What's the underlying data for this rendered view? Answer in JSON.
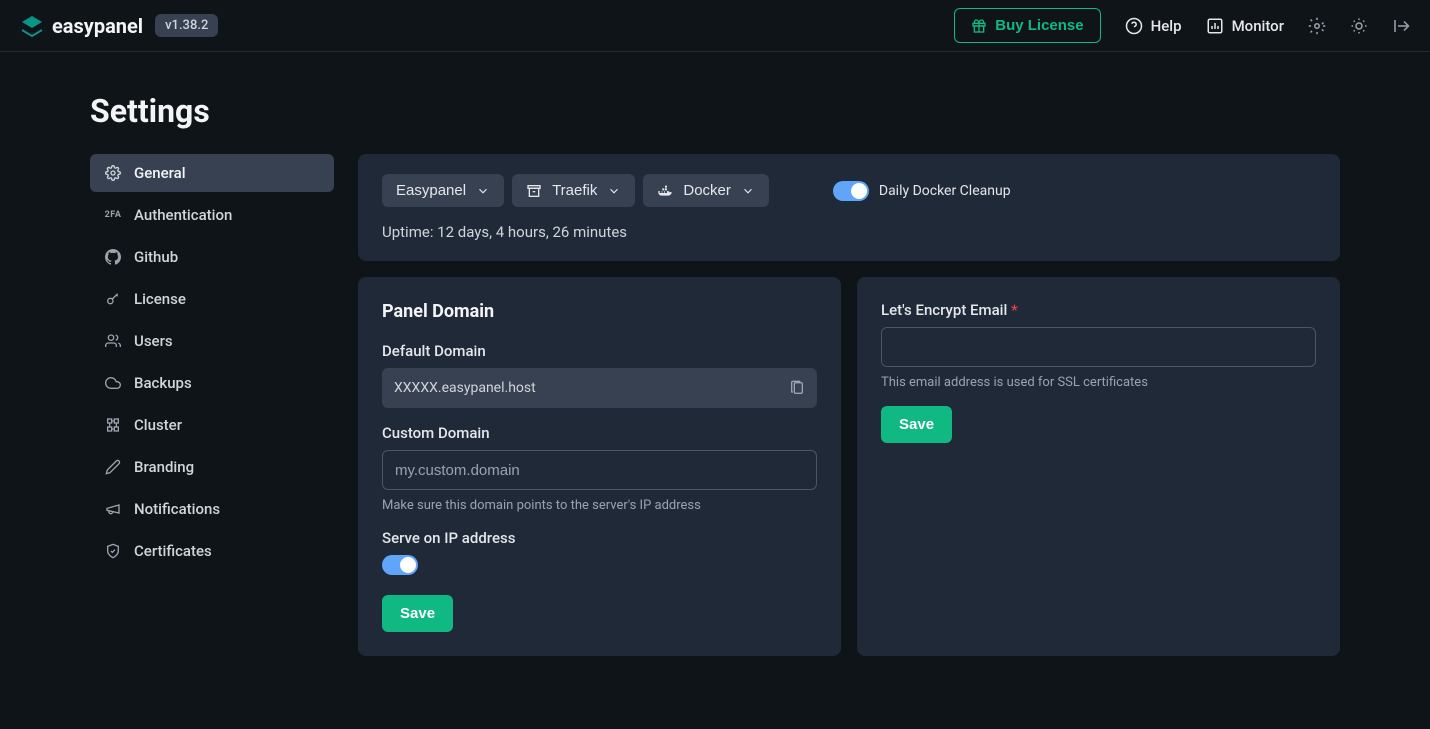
{
  "header": {
    "brand": "easypanel",
    "version": "v1.38.2",
    "buy_license": "Buy License",
    "help": "Help",
    "monitor": "Monitor"
  },
  "page_title": "Settings",
  "sidebar": {
    "items": [
      {
        "label": "General"
      },
      {
        "label": "Authentication"
      },
      {
        "label": "Github"
      },
      {
        "label": "License"
      },
      {
        "label": "Users"
      },
      {
        "label": "Backups"
      },
      {
        "label": "Cluster"
      },
      {
        "label": "Branding"
      },
      {
        "label": "Notifications"
      },
      {
        "label": "Certificates"
      }
    ]
  },
  "top_panel": {
    "easypanel_btn": "Easypanel",
    "traefik_btn": "Traefik",
    "docker_btn": "Docker",
    "daily_cleanup": "Daily Docker Cleanup",
    "uptime": "Uptime: 12 days, 4 hours, 26 minutes"
  },
  "panel_domain": {
    "title": "Panel Domain",
    "default_label": "Default Domain",
    "default_value": "XXXXX.easypanel.host",
    "custom_label": "Custom Domain",
    "custom_placeholder": "my.custom.domain",
    "custom_hint": "Make sure this domain points to the server's IP address",
    "serve_ip_label": "Serve on IP address",
    "save": "Save"
  },
  "lets_encrypt": {
    "label": "Let's Encrypt Email",
    "hint": "This email address is used for SSL certificates",
    "save": "Save"
  }
}
